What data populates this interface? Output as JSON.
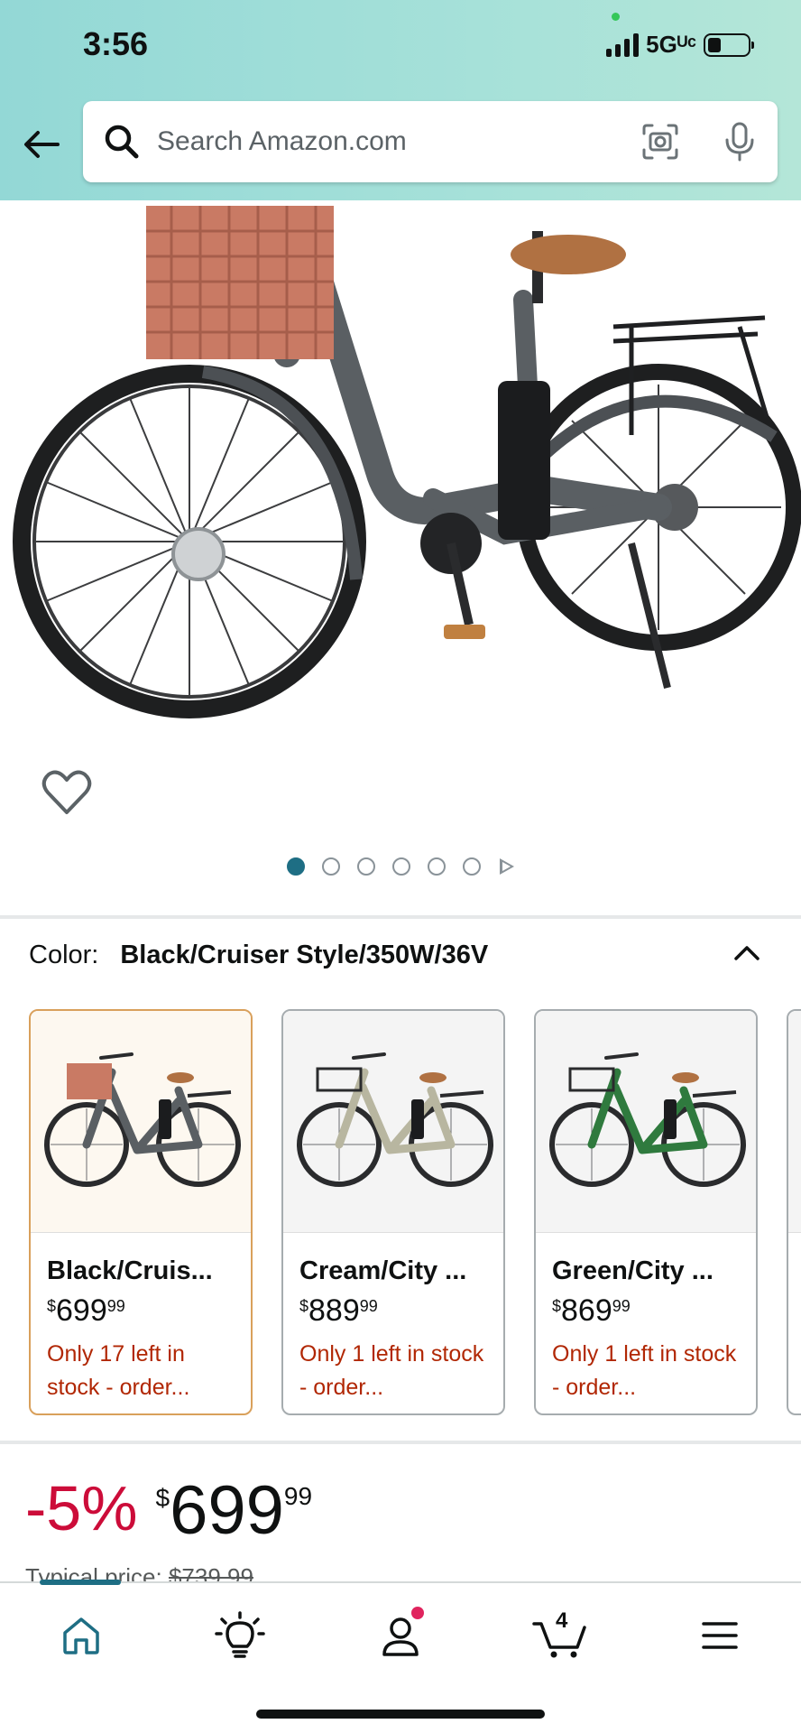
{
  "status_bar": {
    "time": "3:56",
    "network": "5Gᵁᶜ"
  },
  "search": {
    "placeholder": "Search Amazon.com"
  },
  "gallery": {
    "image_count": 6,
    "active_index": 0
  },
  "color": {
    "label": "Color:",
    "selected_value": "Black/Cruiser Style/350W/36V"
  },
  "variants": [
    {
      "name": "Black/Cruis...",
      "price_whole": "699",
      "price_fraction": "99",
      "stock": "Only 17 left in stock - order...",
      "frame_color": "#5a5f63",
      "selected": true
    },
    {
      "name": "Cream/City ...",
      "price_whole": "889",
      "price_fraction": "99",
      "stock": "Only 1 left in stock - order...",
      "frame_color": "#ecebd6",
      "selected": false
    },
    {
      "name": "Green/City ...",
      "price_whole": "869",
      "price_fraction": "99",
      "stock": "Only 1 left in stock - order...",
      "frame_color": "#2f7a3e",
      "selected": false
    }
  ],
  "price": {
    "discount": "-5%",
    "currency": "$",
    "whole": "699",
    "fraction": "99",
    "typical_label": "Typical price:",
    "typical_value": "$739.99"
  },
  "bottom_nav": {
    "cart_count": "4",
    "active": "home"
  },
  "colors": {
    "accent": "#1e6e84",
    "deal_red": "#cc0c39",
    "stock_red": "#b12704",
    "selected_border": "#d9a05b"
  }
}
